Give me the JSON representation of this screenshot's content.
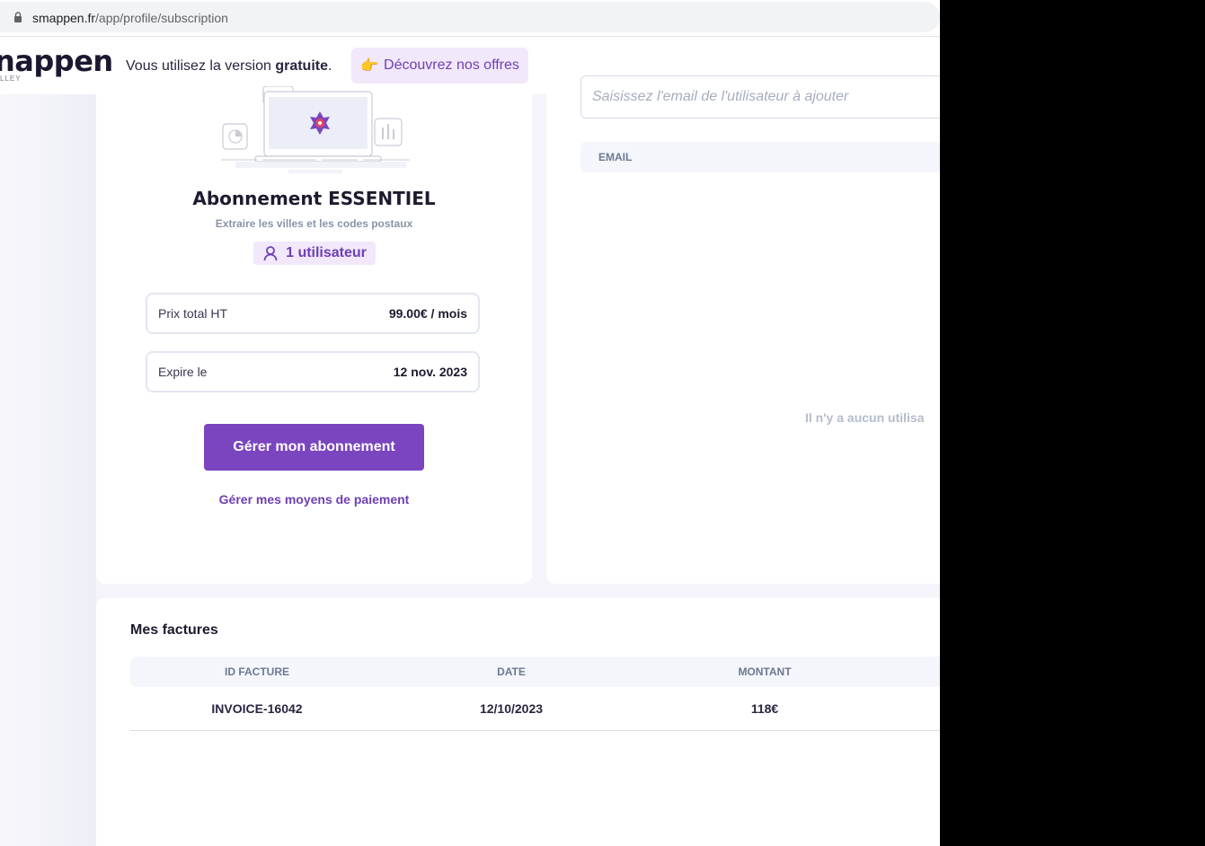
{
  "browser": {
    "url_domain": "smappen.fr",
    "url_path": "/app/profile/subscription"
  },
  "header": {
    "logo_text": "nappen",
    "logo_sub": "LLEY",
    "version_prefix": "Vous utilisez la version ",
    "version_bold": "gratuite",
    "version_suffix": ".",
    "offers_emoji": "👉",
    "offers_label": "Découvrez nos offres"
  },
  "subscription": {
    "title": "Abonnement ESSENTIEL",
    "subtitle": "Extraire les villes et les codes postaux",
    "users_badge": "1 utilisateur",
    "price_label": "Prix total HT",
    "price_value": "99.00€ / mois",
    "expire_label": "Expire le",
    "expire_value": "12 nov. 2023",
    "manage_button": "Gérer mon abonnement",
    "payment_link": "Gérer mes moyens de paiement"
  },
  "users": {
    "email_placeholder": "Saisissez l'email de l'utilisateur à ajouter",
    "column_email": "EMAIL",
    "empty_message": "Il n'y a aucun utilisa"
  },
  "invoices": {
    "title": "Mes factures",
    "columns": [
      "ID FACTURE",
      "DATE",
      "MONTANT"
    ],
    "rows": [
      [
        "INVOICE-16042",
        "12/10/2023",
        "118€"
      ]
    ]
  },
  "colors": {
    "accent": "#7a45bf",
    "accent_light": "#f1e8fb",
    "background": "#f4f4fa"
  }
}
